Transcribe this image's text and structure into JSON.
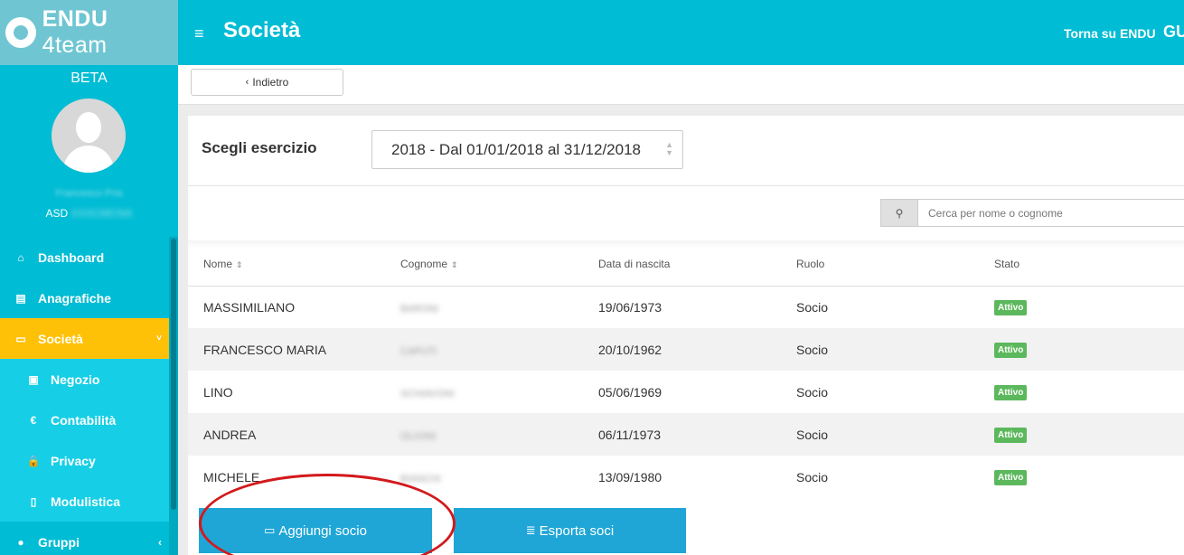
{
  "brand": {
    "name": "ENDU",
    "sub": "4team",
    "beta": "BETA"
  },
  "user": {
    "name": "Francesco Pria",
    "club_prefix": "ASD",
    "club_name": "XXXCMCNA"
  },
  "sidebar": {
    "items": [
      {
        "label": "Dashboard",
        "icon": "home-icon",
        "glyph": "⌂"
      },
      {
        "label": "Anagrafiche",
        "icon": "book-icon",
        "glyph": "▤"
      },
      {
        "label": "Società",
        "icon": "id-card-icon",
        "glyph": "▭",
        "chevron": "˅"
      },
      {
        "label": "Negozio",
        "icon": "money-icon",
        "glyph": "▣"
      },
      {
        "label": "Contabilità",
        "icon": "euro-icon",
        "glyph": "€"
      },
      {
        "label": "Privacy",
        "icon": "lock-icon",
        "glyph": "🔒"
      },
      {
        "label": "Modulistica",
        "icon": "file-pdf-icon",
        "glyph": "▯"
      },
      {
        "label": "Gruppi",
        "icon": "users-icon",
        "glyph": "●",
        "chevron": "‹"
      }
    ]
  },
  "header": {
    "title": "Società",
    "menu_glyph": "≡",
    "torna": "Torna su ENDU",
    "user_initials": "GU"
  },
  "toolbar": {
    "back_label": "Indietro",
    "back_glyph": "‹"
  },
  "filter": {
    "label": "Scegli esercizio",
    "selected": "2018 - Dal 01/01/2018 al 31/12/2018",
    "search_placeholder": "Cerca per nome o cognome",
    "search_glyph": "⚲"
  },
  "table": {
    "columns": [
      "Nome",
      "Cognome",
      "Data di nascita",
      "Ruolo",
      "Stato"
    ],
    "sort_glyph": "⇕",
    "rows": [
      {
        "nome": "MASSIMILIANO",
        "cognome": "BARONI",
        "data": "19/06/1973",
        "ruolo": "Socio",
        "stato": "Attivo"
      },
      {
        "nome": "FRANCESCO MARIA",
        "cognome": "CAPUTI",
        "data": "20/10/1962",
        "ruolo": "Socio",
        "stato": "Attivo"
      },
      {
        "nome": "LINO",
        "cognome": "SCHIAVONI",
        "data": "05/06/1969",
        "ruolo": "Socio",
        "stato": "Attivo"
      },
      {
        "nome": "ANDREA",
        "cognome": "OLIVINI",
        "data": "06/11/1973",
        "ruolo": "Socio",
        "stato": "Attivo"
      },
      {
        "nome": "MICHELE",
        "cognome": "BIANCHI",
        "data": "13/09/1980",
        "ruolo": "Socio",
        "stato": "Attivo"
      }
    ]
  },
  "actions": {
    "add_label": "Aggiungi socio",
    "add_glyph": "▭",
    "export_label": "Esporta soci",
    "export_glyph": "≣"
  },
  "colors": {
    "primary": "#00bcd4",
    "active": "#ffc107",
    "button": "#1fa6d6",
    "badge": "#5cb85c",
    "highlight": "#d3191c"
  }
}
